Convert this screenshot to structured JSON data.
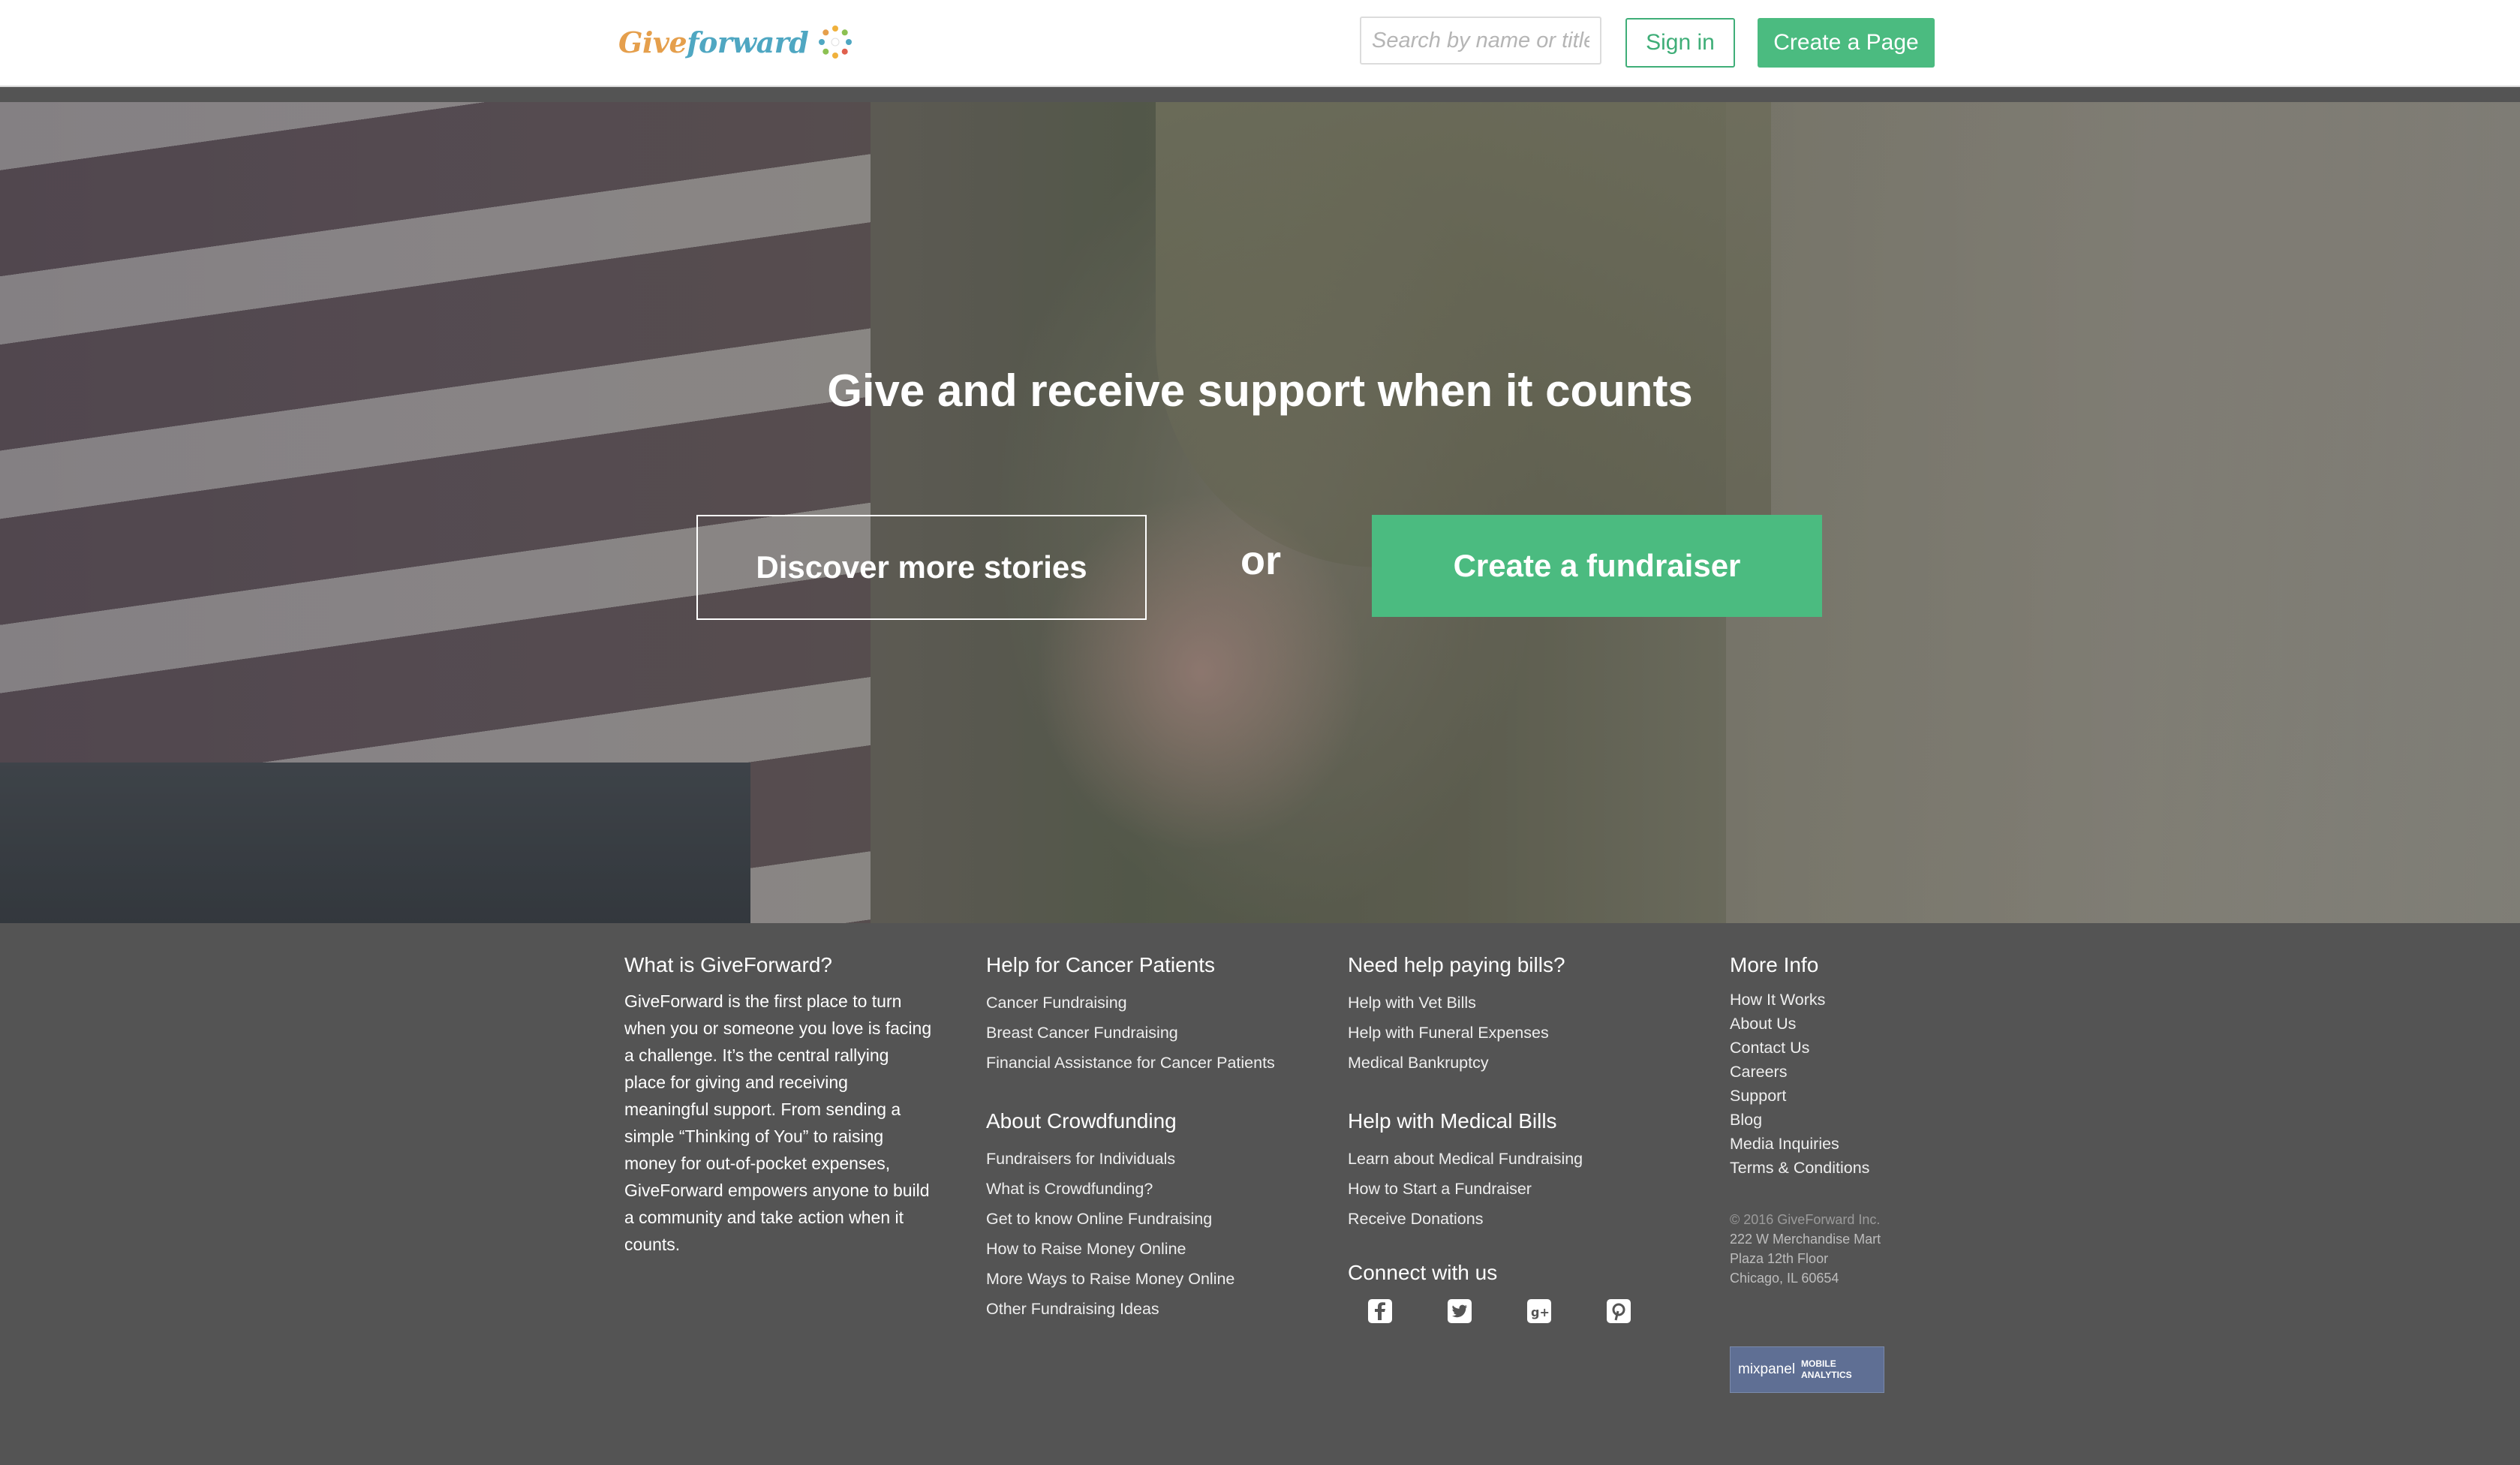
{
  "header": {
    "logo_give": "Give",
    "logo_forward": "forward",
    "search_placeholder": "Search by name or title",
    "signin_label": "Sign in",
    "create_page_label": "Create a Page"
  },
  "hero": {
    "title": "Give and receive support when it counts",
    "discover_label": "Discover more stories",
    "or_label": "or",
    "fundraiser_label": "Create a fundraiser"
  },
  "footer": {
    "what": {
      "title": "What is GiveForward?",
      "text": "GiveForward is the first place to turn when you or someone you love is facing a challenge. It’s the central rallying place for giving and receiving meaningful support. From sending a simple “Thinking of You” to raising money for out-of-pocket expenses, GiveForward empowers anyone to build a community and take action when it counts."
    },
    "cancer": {
      "title": "Help for Cancer Patients",
      "links": [
        "Cancer Fundraising",
        "Breast Cancer Fundraising",
        "Financial Assistance for Cancer Patients"
      ]
    },
    "crowdfunding": {
      "title": "About Crowdfunding",
      "links": [
        "Fundraisers for Individuals",
        "What is Crowdfunding?",
        "Get to know Online Fundraising",
        "How to Raise Money Online",
        "More Ways to Raise Money Online",
        "Other Fundraising Ideas"
      ]
    },
    "bills": {
      "title": "Need help paying bills?",
      "links": [
        "Help with Vet Bills",
        "Help with Funeral Expenses",
        "Medical Bankruptcy"
      ]
    },
    "medical": {
      "title": "Help with Medical Bills",
      "links": [
        "Learn about Medical Fundraising",
        "How to Start a Fundraiser",
        "Receive Donations"
      ]
    },
    "connect": {
      "title": "Connect with us",
      "icons": [
        "facebook-icon",
        "twitter-icon",
        "google-plus-icon",
        "pinterest-icon"
      ]
    },
    "more": {
      "title": "More Info",
      "links": [
        "How It Works",
        "About Us",
        "Contact Us",
        "Careers",
        "Support",
        "Blog",
        "Media Inquiries",
        "Terms & Conditions"
      ]
    },
    "copyright": [
      "© 2016 GiveForward Inc.",
      "222 W Merchandise Mart",
      "Plaza 12th Floor",
      "Chicago, IL 60654"
    ],
    "badge": {
      "name": "mixpanel",
      "tag_line1": "MOBILE",
      "tag_line2": "ANALYTICS"
    }
  },
  "colors": {
    "accent": "#4bbb80",
    "logo_orange": "#e59f4c",
    "logo_blue": "#4fa7c2",
    "footer_bg": "#545454"
  }
}
